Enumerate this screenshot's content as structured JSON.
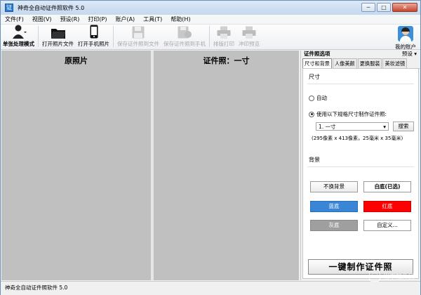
{
  "window": {
    "title": "神奇全自动证件照软件 5.0",
    "minimize": "─",
    "maximize": "□",
    "close": "✕"
  },
  "menu": [
    "文件(F)",
    "视图(V)",
    "预设(R)",
    "打印(P)",
    "账户(A)",
    "工具(T)",
    "帮助(H)"
  ],
  "toolbar": {
    "single_mode": "单张处理模式",
    "open_file": "打开照片文件",
    "open_phone": "打开手机照片",
    "save_to_file": "保存证件照到文件",
    "save_to_phone": "保存证件照到手机",
    "print_layout": "排版打印",
    "print_preview": "冲印预览",
    "account": "我的账户"
  },
  "preview": {
    "original": "原照片",
    "id_photo": "证件照：一寸"
  },
  "side": {
    "title": "证件照选项",
    "preset": "预设",
    "tabs": [
      "尺寸和背景",
      "人像美颜",
      "更换服装",
      "美妆滤镜"
    ],
    "size_section": "尺寸",
    "auto": "自动",
    "use_spec": "使用以下规格尺寸制作证件照:",
    "spec_value": "1. 一寸",
    "search": "搜索",
    "spec_desc": "(295像素 x 413像素，25毫米 x 35毫米)",
    "bg_section": "背景",
    "bg_buttons": {
      "no_change": "不换背景",
      "white": "白底(已选)",
      "blue": "蓝底",
      "red": "红底",
      "gray": "灰底",
      "custom": "自定义..."
    },
    "make_button": "一键制作证件照"
  },
  "colors": {
    "blue": "#3a86d6",
    "red": "#ff0000",
    "gray": "#9f9f9f"
  },
  "status": "神奇全自动证件照软件 5.0",
  "watermark": "当下软件园"
}
